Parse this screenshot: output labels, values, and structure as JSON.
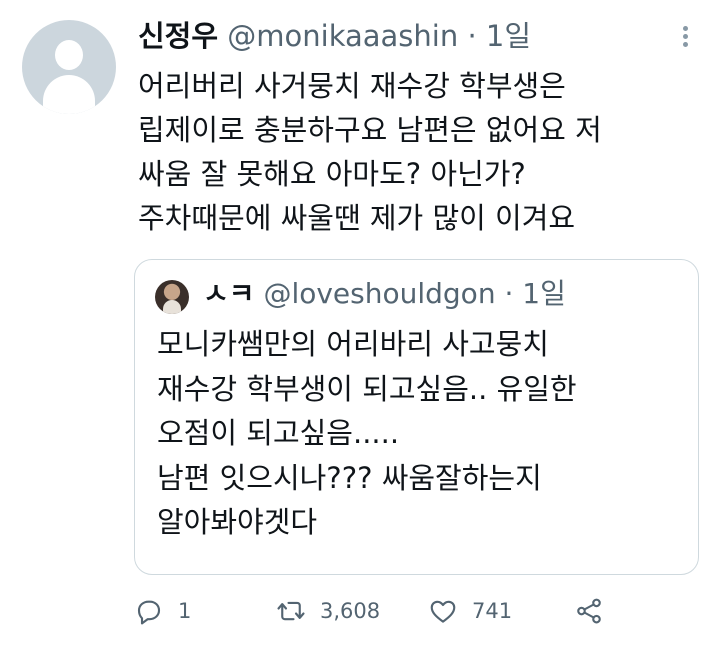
{
  "tweet": {
    "author_name": "신정우",
    "handle": "@monikaaashin",
    "separator": "·",
    "time": "1일",
    "lines": [
      "어리버리 사거뭉치 재수강 학부생은",
      "립제이로 충분하구요 남편은 없어요 저",
      "싸움 잘 못해요 아마도? 아닌가?",
      "주차때문에 싸울땐 제가 많이 이겨요"
    ]
  },
  "quoted_tweet": {
    "author_name": "ㅅㅋ",
    "handle": "@loveshouldgon",
    "separator": "·",
    "time": "1일",
    "lines": [
      "모니카쌤만의 어리바리 사고뭉치",
      "재수강 학부생이 되고싶음.. 유일한",
      "오점이 되고싶음.....",
      "남편 잇으시나??? 싸움잘하는지",
      "알아봐야겟다"
    ]
  },
  "actions": {
    "reply_count": "1",
    "retweet_count": "3,608",
    "like_count": "741"
  },
  "icons": {
    "reply": "reply-icon",
    "retweet": "retweet-icon",
    "like": "heart-icon",
    "share": "share-icon",
    "more": "more-icon"
  },
  "colors": {
    "text": "#0f1419",
    "secondary": "#536471",
    "border": "#cfd9de",
    "avatar_placeholder": "#ccd6dd"
  }
}
